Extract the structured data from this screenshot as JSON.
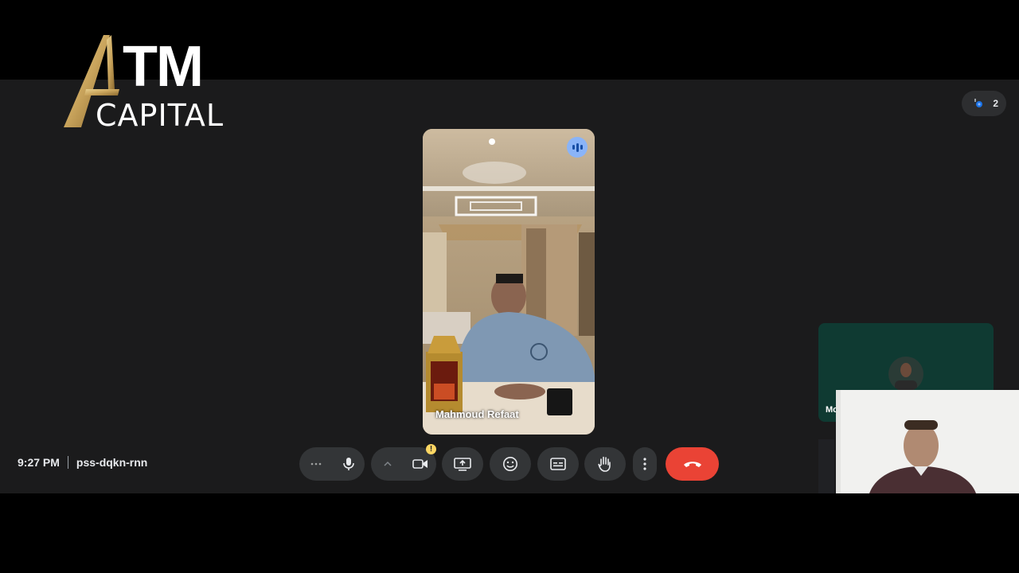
{
  "branding": {
    "logo_top": "TM",
    "logo_bottom": "CAPITAL",
    "gold_color": "#c9a45c"
  },
  "meeting": {
    "time": "9:27 PM",
    "code": "pss-dqkn-rnn"
  },
  "participants": {
    "count": "2",
    "icon": "people-icon"
  },
  "main_tile": {
    "name": "Mahmoud Refaat",
    "speaking_icon": "audio-level-icon"
  },
  "side_tile": {
    "name": "Mo"
  },
  "controls": {
    "more_options_icon": "more-horizontal-icon",
    "mic_icon": "microphone-icon",
    "mic_options_icon": "chevron-up-icon",
    "camera_icon": "camera-icon",
    "camera_warning": "!",
    "present_icon": "present-screen-icon",
    "emoji_icon": "emoji-icon",
    "captions_icon": "closed-captions-icon",
    "hand_icon": "raise-hand-icon",
    "more_icon": "more-vertical-icon",
    "leave_icon": "hang-up-icon"
  },
  "colors": {
    "leave": "#ea4335",
    "speaking": "#8ab4f8",
    "warning": "#fdd663"
  }
}
